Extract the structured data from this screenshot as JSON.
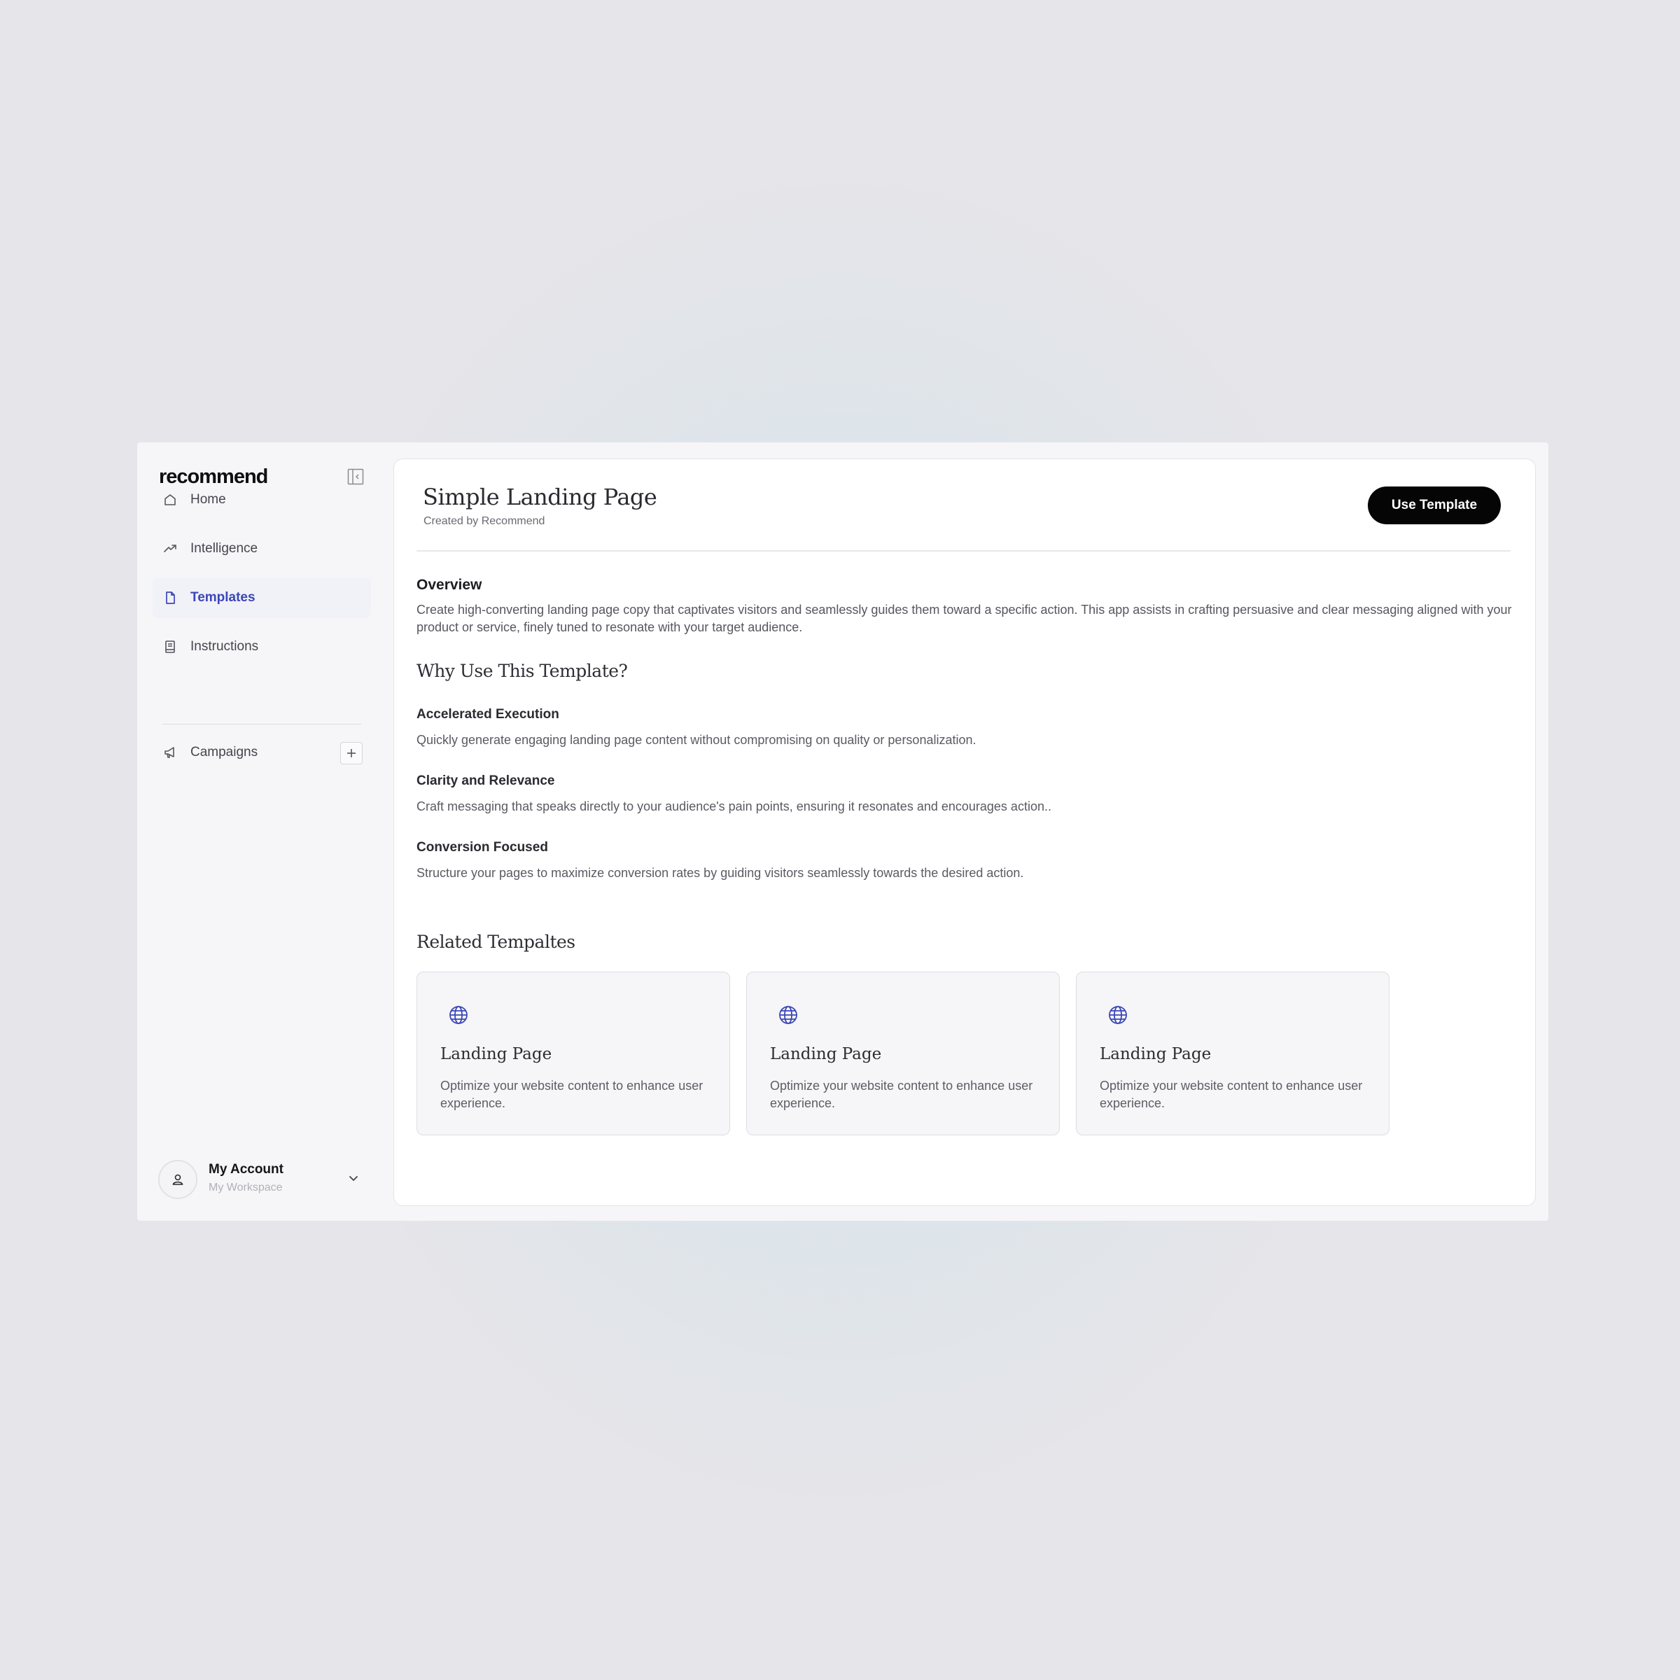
{
  "app": {
    "logo": "recommend"
  },
  "sidebar": {
    "items": [
      {
        "label": "Home",
        "icon": "home-icon"
      },
      {
        "label": "Intelligence",
        "icon": "trend-icon"
      },
      {
        "label": "Templates",
        "icon": "document-icon",
        "active": true
      },
      {
        "label": "Instructions",
        "icon": "book-icon"
      },
      {
        "label": "Campaigns",
        "icon": "megaphone-icon"
      }
    ],
    "account": {
      "name": "My Account",
      "workspace": "My Workspace"
    }
  },
  "main": {
    "title": "Simple Landing Page",
    "subtitle": "Created by Recommend",
    "use_button": "Use Template",
    "overview": {
      "heading": "Overview",
      "text": "Create high-converting landing page copy that captivates visitors and seamlessly guides them toward a specific action. This app assists in crafting persuasive and clear messaging aligned with your product or service, finely tuned to resonate with your target audience."
    },
    "why": {
      "heading": "Why Use This Template?",
      "points": [
        {
          "title": "Accelerated Execution",
          "text": "Quickly generate engaging landing page content without compromising on quality or personalization."
        },
        {
          "title": "Clarity and Relevance",
          "text": "Craft messaging that speaks directly to your audience's pain points, ensuring it resonates and encourages action.."
        },
        {
          "title": "Conversion Focused",
          "text": "Structure your pages to maximize conversion rates by guiding visitors seamlessly towards the desired action."
        }
      ]
    },
    "related": {
      "heading": "Related Tempaltes",
      "cards": [
        {
          "title": "Landing Page",
          "desc": "Optimize your website content to enhance user experience.",
          "icon": "globe-icon"
        },
        {
          "title": "Landing Page",
          "desc": "Optimize your website content to enhance user experience.",
          "icon": "globe-icon"
        },
        {
          "title": "Landing Page",
          "desc": "Optimize your website content to enhance user experience.",
          "icon": "globe-icon"
        }
      ]
    }
  },
  "colors": {
    "accent": "#3b47b5",
    "button": "#050505",
    "background": "#e6e5e9"
  }
}
